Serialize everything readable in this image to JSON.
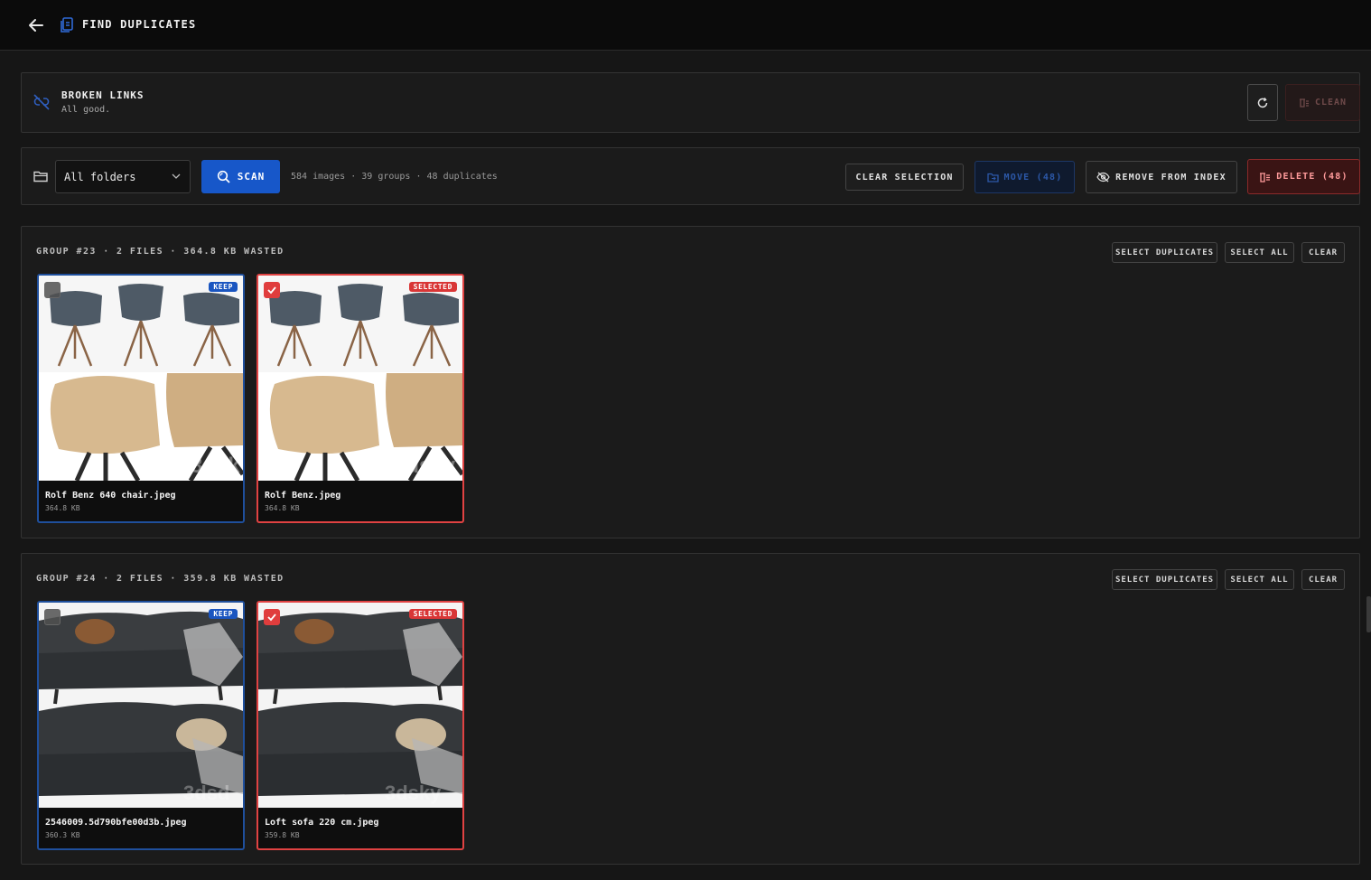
{
  "header": {
    "title": "FIND DUPLICATES",
    "back_icon": "arrow-left-icon",
    "title_icon": "duplicate-files-icon"
  },
  "broken_links": {
    "title": "BROKEN LINKS",
    "status": "All good.",
    "icon": "broken-link-icon",
    "refresh_icon": "refresh-icon",
    "clean_label": "CLEAN"
  },
  "toolbar": {
    "folder_select": "All folders",
    "scan_label": "SCAN",
    "stats": "584 images · 39 groups · 48 duplicates",
    "clear_selection_label": "CLEAR SELECTION",
    "move_label": "MOVE (48)",
    "remove_label": "REMOVE FROM INDEX",
    "delete_label": "DELETE (48)"
  },
  "group_actions": {
    "select_duplicates": "SELECT DUPLICATES",
    "select_all": "SELECT ALL",
    "clear": "CLEAR"
  },
  "groups": [
    {
      "title": "GROUP #23 · 2 FILES · 364.8 KB WASTED",
      "files": [
        {
          "name": "Rolf Benz 640 chair.jpeg",
          "size": "364.8 KB",
          "badge": "KEEP",
          "checked": false
        },
        {
          "name": "Rolf Benz.jpeg",
          "size": "364.8 KB",
          "badge": "SELECTED",
          "checked": true
        }
      ]
    },
    {
      "title": "GROUP #24 · 2 FILES · 359.8 KB WASTED",
      "files": [
        {
          "name": "2546009.5d790bfe00d3b.jpeg",
          "size": "360.3 KB",
          "badge": "KEEP",
          "checked": false
        },
        {
          "name": "Loft sofa 220 cm.jpeg",
          "size": "359.8 KB",
          "badge": "SELECTED",
          "checked": true
        }
      ]
    }
  ],
  "colors": {
    "accent_blue": "#1757c9",
    "danger_red": "#e04242",
    "background": "#161616",
    "panel": "#1b1b1b"
  }
}
